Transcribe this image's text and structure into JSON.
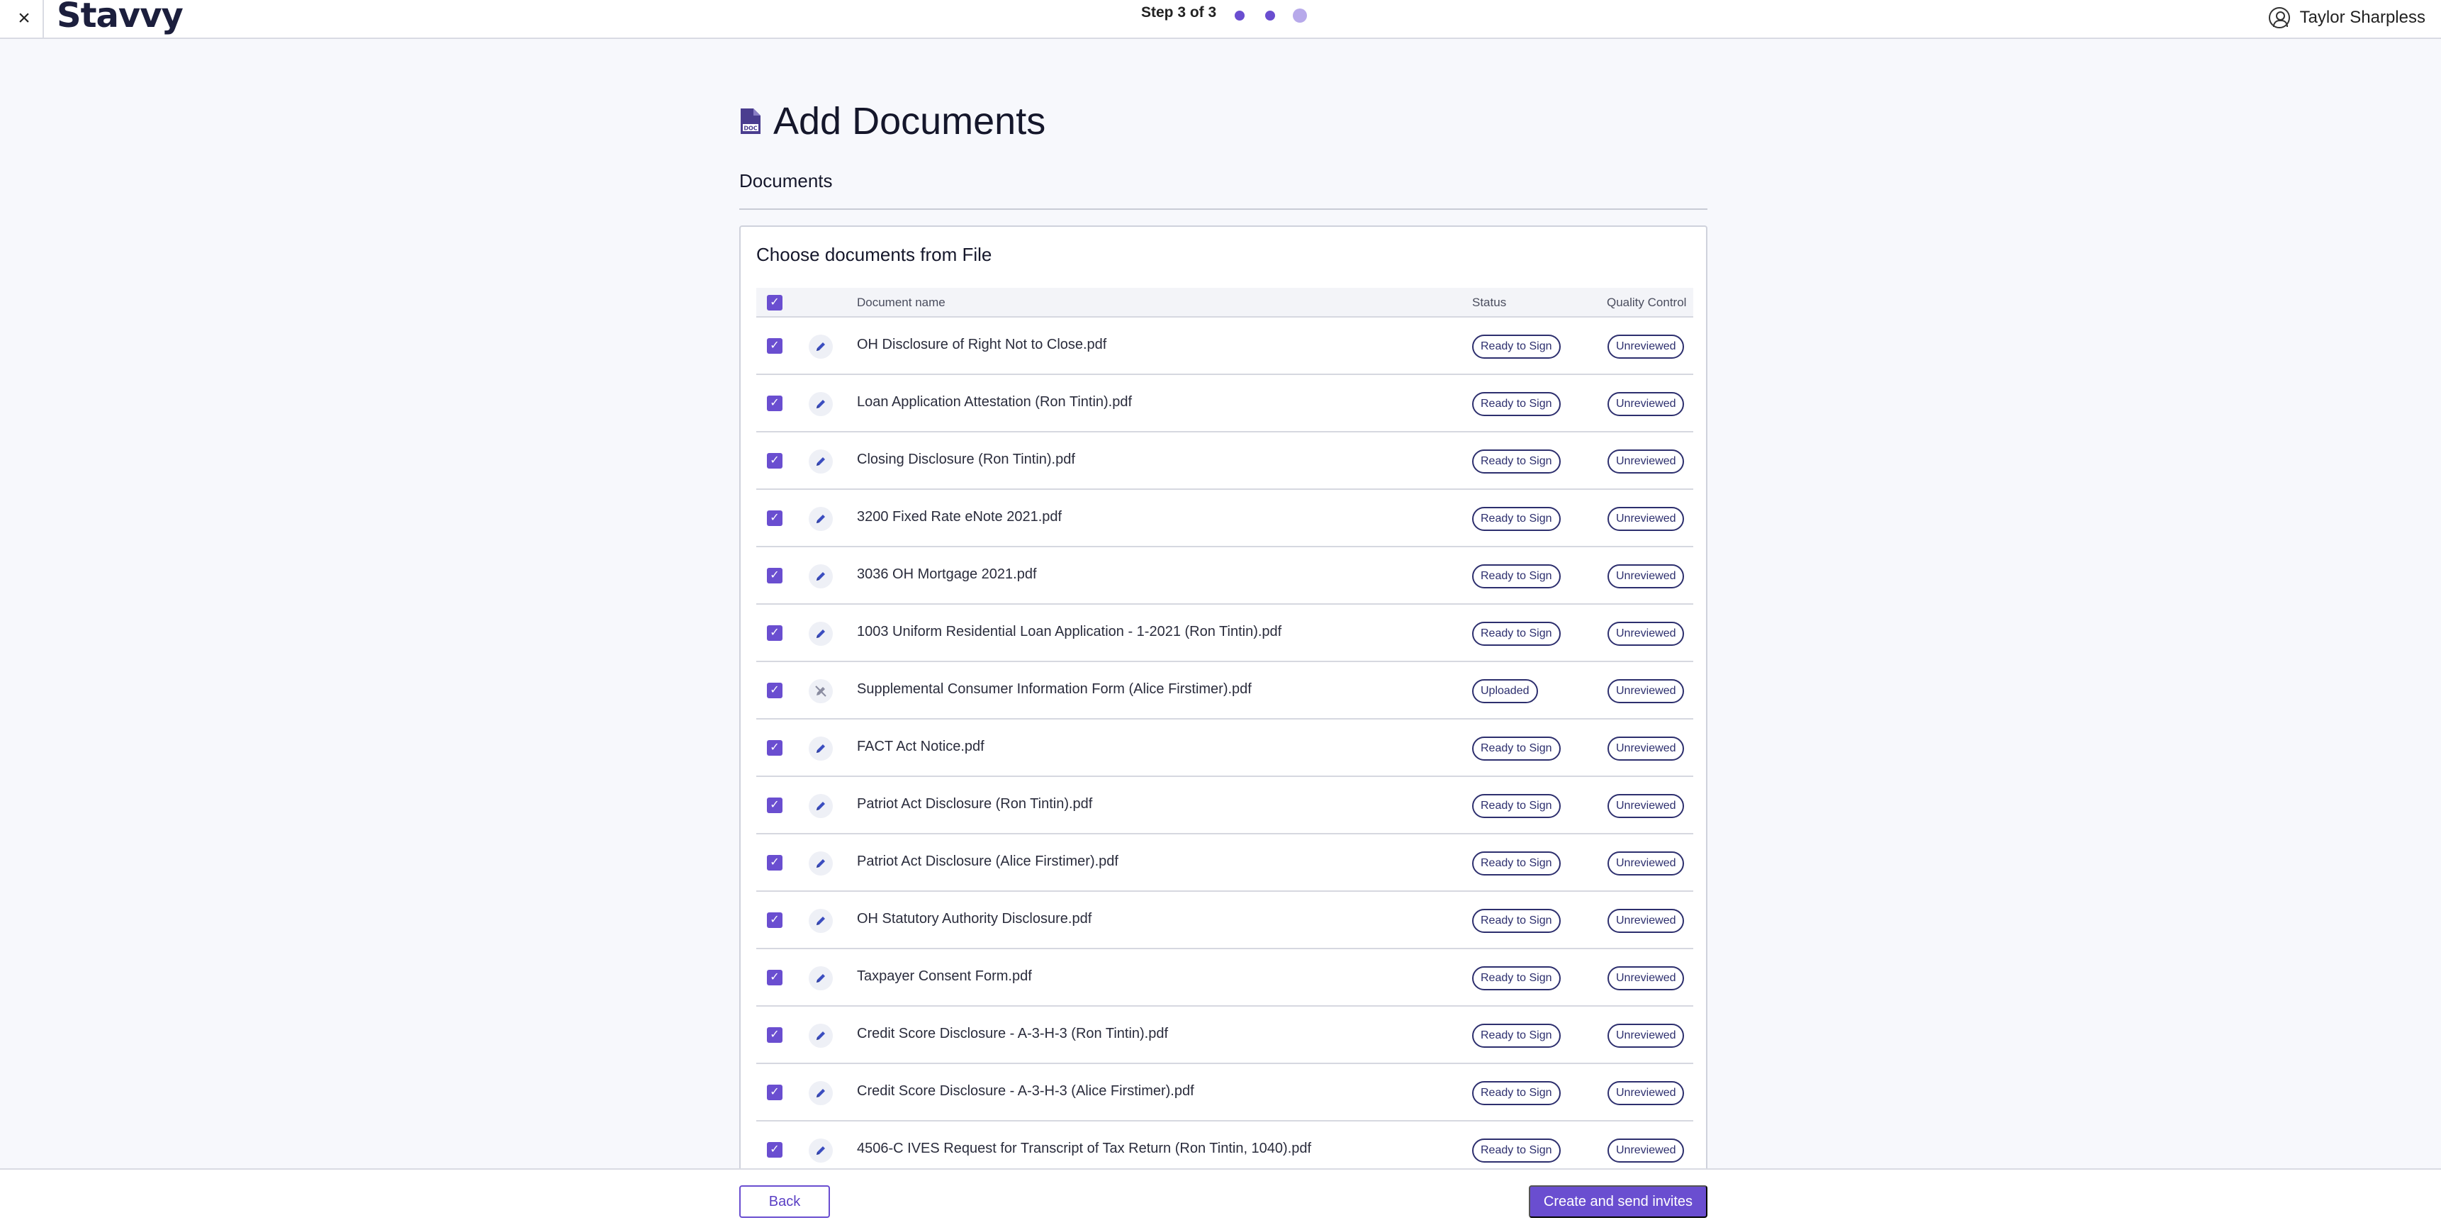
{
  "header": {
    "close_glyph": "×",
    "logo": "Stavvy",
    "step": "Step 3 of 3",
    "user_name": "Taylor Sharpless"
  },
  "page": {
    "title": "Add Documents",
    "section_label": "Documents",
    "card_title": "Choose documents from File"
  },
  "table": {
    "columns": {
      "name": "Document name",
      "status": "Status",
      "qc": "Quality Control"
    },
    "rows": [
      {
        "name": "OH Disclosure of Right Not to Close.pdf",
        "status": "Ready to Sign",
        "qc": "Unreviewed",
        "action_icon": "pencil-icon"
      },
      {
        "name": "Loan Application Attestation (Ron Tintin).pdf",
        "status": "Ready to Sign",
        "qc": "Unreviewed",
        "action_icon": "pencil-icon"
      },
      {
        "name": "Closing Disclosure (Ron Tintin).pdf",
        "status": "Ready to Sign",
        "qc": "Unreviewed",
        "action_icon": "pencil-icon"
      },
      {
        "name": "3200 Fixed Rate eNote 2021.pdf",
        "status": "Ready to Sign",
        "qc": "Unreviewed",
        "action_icon": "pencil-icon"
      },
      {
        "name": "3036 OH Mortgage 2021.pdf",
        "status": "Ready to Sign",
        "qc": "Unreviewed",
        "action_icon": "pencil-icon"
      },
      {
        "name": "1003 Uniform Residential Loan Application - 1-2021 (Ron Tintin).pdf",
        "status": "Ready to Sign",
        "qc": "Unreviewed",
        "action_icon": "pencil-icon"
      },
      {
        "name": "Supplemental Consumer Information Form (Alice Firstimer).pdf",
        "status": "Uploaded",
        "qc": "Unreviewed",
        "action_icon": "pencil-off-icon"
      },
      {
        "name": "FACT Act Notice.pdf",
        "status": "Ready to Sign",
        "qc": "Unreviewed",
        "action_icon": "pencil-icon"
      },
      {
        "name": "Patriot Act Disclosure (Ron Tintin).pdf",
        "status": "Ready to Sign",
        "qc": "Unreviewed",
        "action_icon": "pencil-icon"
      },
      {
        "name": "Patriot Act Disclosure (Alice Firstimer).pdf",
        "status": "Ready to Sign",
        "qc": "Unreviewed",
        "action_icon": "pencil-icon"
      },
      {
        "name": "OH Statutory Authority Disclosure.pdf",
        "status": "Ready to Sign",
        "qc": "Unreviewed",
        "action_icon": "pencil-icon"
      },
      {
        "name": "Taxpayer Consent Form.pdf",
        "status": "Ready to Sign",
        "qc": "Unreviewed",
        "action_icon": "pencil-icon"
      },
      {
        "name": "Credit Score Disclosure - A-3-H-3 (Ron Tintin).pdf",
        "status": "Ready to Sign",
        "qc": "Unreviewed",
        "action_icon": "pencil-icon"
      },
      {
        "name": "Credit Score Disclosure - A-3-H-3 (Alice Firstimer).pdf",
        "status": "Ready to Sign",
        "qc": "Unreviewed",
        "action_icon": "pencil-icon"
      },
      {
        "name": "4506-C IVES Request for Transcript of Tax Return (Ron Tintin, 1040).pdf",
        "status": "Ready to Sign",
        "qc": "Unreviewed",
        "action_icon": "pencil-icon"
      }
    ]
  },
  "footer": {
    "back_label": "Back",
    "create_label": "Create and send invites"
  },
  "colors": {
    "accent": "#6a4ed0",
    "badge_border": "#2d2f6e",
    "background": "#f7f8fc"
  }
}
